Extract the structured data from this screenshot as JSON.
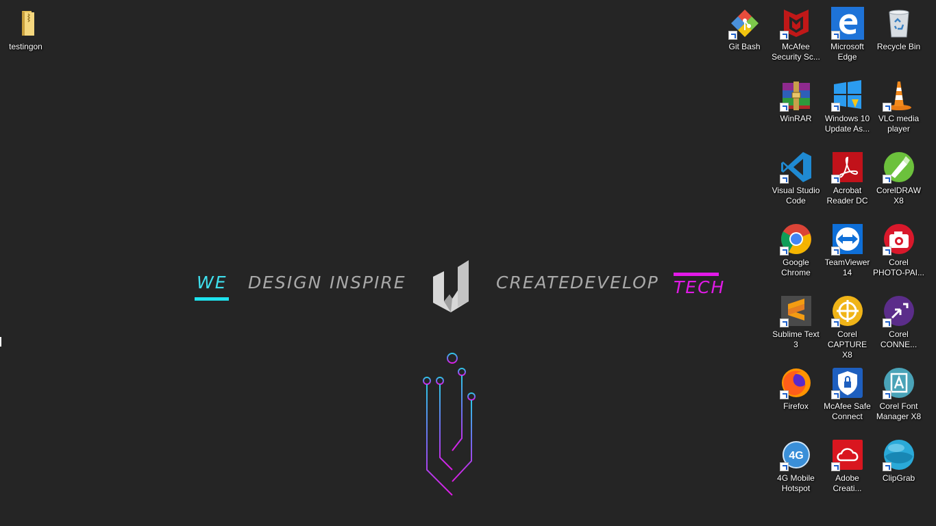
{
  "desktop": {
    "icons": [
      {
        "label": "testingon",
        "icon": "folder-icon"
      },
      {
        "label": "Git Bash",
        "icon": "git-bash-icon"
      },
      {
        "label": "McAfee\nSecurity Sc...",
        "icon": "mcafee-security-scan-icon"
      },
      {
        "label": "Microsoft\nEdge",
        "icon": "microsoft-edge-icon"
      },
      {
        "label": "Recycle Bin",
        "icon": "recycle-bin-icon"
      },
      {
        "label": "WinRAR",
        "icon": "winrar-icon"
      },
      {
        "label": "Windows 10\nUpdate As...",
        "icon": "windows-update-assistant-icon"
      },
      {
        "label": "VLC media\nplayer",
        "icon": "vlc-icon"
      },
      {
        "label": "Visual Studio\nCode",
        "icon": "vscode-icon"
      },
      {
        "label": "Acrobat\nReader DC",
        "icon": "acrobat-reader-icon"
      },
      {
        "label": "CorelDRAW\nX8",
        "icon": "coreldraw-icon"
      },
      {
        "label": "Google\nChrome",
        "icon": "chrome-icon"
      },
      {
        "label": "TeamViewer\n14",
        "icon": "teamviewer-icon"
      },
      {
        "label": "Corel\nPHOTO-PAI...",
        "icon": "corel-photo-paint-icon"
      },
      {
        "label": "Sublime Text\n3",
        "icon": "sublime-text-icon"
      },
      {
        "label": "Corel\nCAPTURE X8",
        "icon": "corel-capture-icon"
      },
      {
        "label": "Corel\nCONNE...",
        "icon": "corel-connect-icon"
      },
      {
        "label": "Firefox",
        "icon": "firefox-icon"
      },
      {
        "label": "McAfee Safe\nConnect",
        "icon": "mcafee-safe-connect-icon"
      },
      {
        "label": "Corel Font\nManager X8",
        "icon": "corel-font-manager-icon"
      },
      {
        "label": "4G Mobile\nHotspot",
        "icon": "mobile-hotspot-icon"
      },
      {
        "label": "Adobe\nCreati...",
        "icon": "adobe-creative-cloud-icon"
      },
      {
        "label": "ClipGrab",
        "icon": "clipgrab-icon"
      }
    ]
  },
  "wallpaper": {
    "words": [
      "WE",
      "DESIGN",
      "INSPIRE",
      "CREATE",
      "DEVELOP",
      "TECH"
    ],
    "accent_cyan": "#1ee3ee",
    "accent_magenta": "#e21ae8",
    "background": "#252525"
  }
}
